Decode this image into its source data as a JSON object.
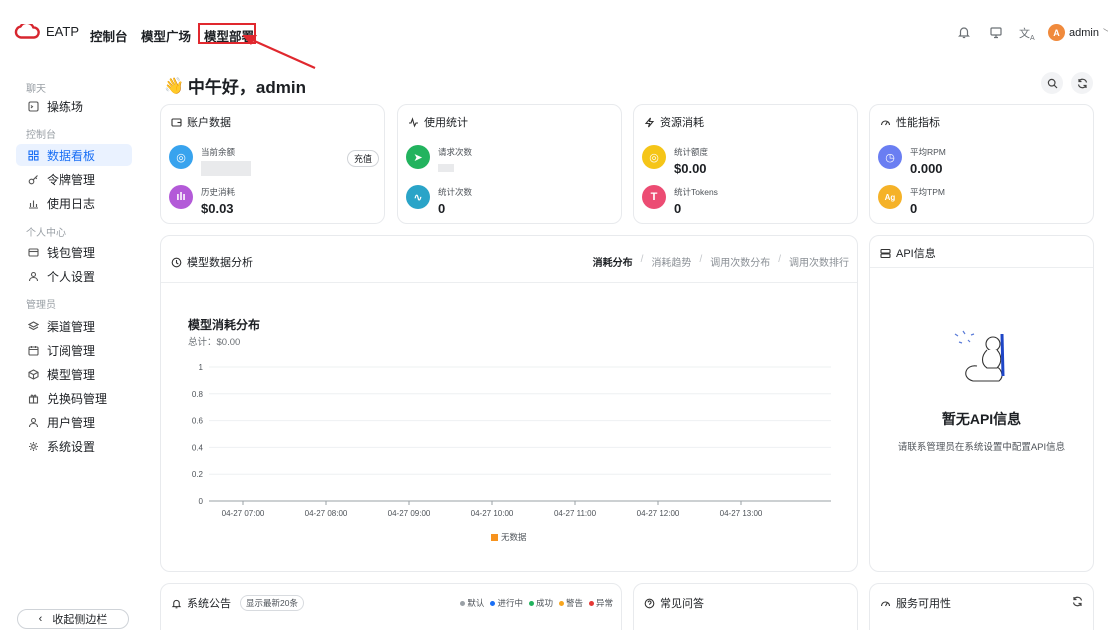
{
  "header": {
    "logo_text": "EATP",
    "nav": [
      "控制台",
      "模型广场",
      "模型部署"
    ],
    "user": {
      "avatar_letter": "A",
      "name": "admin"
    }
  },
  "sidebar": {
    "groups": [
      {
        "label": "聊天",
        "items": [
          {
            "label": "操练场",
            "icon": "chat-window-icon"
          }
        ]
      },
      {
        "label": "控制台",
        "items": [
          {
            "label": "数据看板",
            "icon": "dashboard-grid-icon",
            "active": true
          },
          {
            "label": "令牌管理",
            "icon": "key-icon"
          },
          {
            "label": "使用日志",
            "icon": "bar-chart-icon"
          }
        ]
      },
      {
        "label": "个人中心",
        "items": [
          {
            "label": "钱包管理",
            "icon": "wallet-icon"
          },
          {
            "label": "个人设置",
            "icon": "user-icon"
          }
        ]
      },
      {
        "label": "管理员",
        "items": [
          {
            "label": "渠道管理",
            "icon": "layers-icon"
          },
          {
            "label": "订阅管理",
            "icon": "calendar-icon"
          },
          {
            "label": "模型管理",
            "icon": "cube-icon"
          },
          {
            "label": "兑换码管理",
            "icon": "gift-icon"
          },
          {
            "label": "用户管理",
            "icon": "users-icon"
          },
          {
            "label": "系统设置",
            "icon": "gear-icon"
          }
        ]
      }
    ],
    "collapse_label": "收起侧边栏"
  },
  "main": {
    "greeting": "中午好，admin",
    "cards": {
      "account": {
        "title": "账户数据",
        "balance_label": "当前余额",
        "recharge_label": "充值",
        "history_label": "历史消耗",
        "history_value": "$0.03"
      },
      "usage": {
        "title": "使用统计",
        "requests_label": "请求次数",
        "count_label": "统计次数",
        "count_value": "0"
      },
      "resource": {
        "title": "资源消耗",
        "quota_label": "统计额度",
        "quota_value": "$0.00",
        "tokens_label": "统计Tokens",
        "tokens_value": "0"
      },
      "performance": {
        "title": "性能指标",
        "rpm_label": "平均RPM",
        "rpm_value": "0.000",
        "tpm_label": "平均TPM",
        "tpm_value": "0",
        "tpm_badge": "Ag"
      }
    },
    "analysis": {
      "title": "模型数据分析",
      "tabs": [
        "消耗分布",
        "消耗趋势",
        "调用次数分布",
        "调用次数排行"
      ],
      "active_tab": 0
    },
    "api": {
      "title": "API信息",
      "empty_title": "暂无API信息",
      "empty_desc": "请联系管理员在系统设置中配置API信息"
    },
    "notice": {
      "title": "系统公告",
      "badge": "显示最新20条",
      "legend": [
        {
          "label": "默认",
          "color": "#9aa0a6"
        },
        {
          "label": "进行中",
          "color": "#1a6ff5"
        },
        {
          "label": "成功",
          "color": "#22b35e"
        },
        {
          "label": "警告",
          "color": "#f7a51e"
        },
        {
          "label": "异常",
          "color": "#e53935"
        }
      ]
    },
    "faq": {
      "title": "常见问答"
    },
    "availability": {
      "title": "服务可用性"
    }
  },
  "chart_data": {
    "type": "bar",
    "title": "模型消耗分布",
    "subtitle": "总计：$0.00",
    "categories": [
      "04-27 07:00",
      "04-27 08:00",
      "04-27 09:00",
      "04-27 10:00",
      "04-27 11:00",
      "04-27 12:00",
      "04-27 13:00"
    ],
    "series": [
      {
        "name": "无数据",
        "values": [
          0,
          0,
          0,
          0,
          0,
          0,
          0
        ],
        "color": "#f7931e"
      }
    ],
    "y_ticks": [
      "0",
      "0.2",
      "0.4",
      "0.6",
      "0.8",
      "1"
    ],
    "ylim": [
      0,
      1
    ],
    "grid": true,
    "legend": "bottom"
  }
}
